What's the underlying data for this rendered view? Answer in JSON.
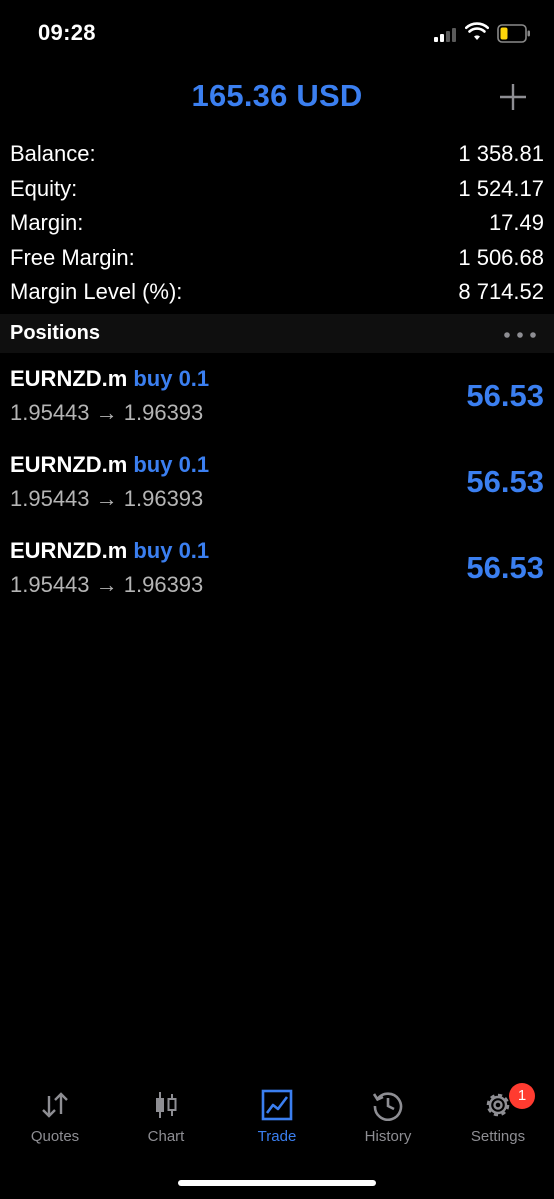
{
  "status_bar": {
    "time": "09:28"
  },
  "header": {
    "title": "165.36 USD",
    "add_icon": "plus-icon"
  },
  "summary": [
    {
      "label": "Balance:",
      "value": "1 358.81"
    },
    {
      "label": "Equity:",
      "value": "1 524.17"
    },
    {
      "label": "Margin:",
      "value": "17.49"
    },
    {
      "label": "Free Margin:",
      "value": "1 506.68"
    },
    {
      "label": "Margin Level (%):",
      "value": "8 714.52"
    }
  ],
  "positions": {
    "title": "Positions",
    "items": [
      {
        "symbol": "EURNZD.m",
        "type": "buy 0.1",
        "prices": "1.95443 → 1.96393",
        "profit": "56.53"
      },
      {
        "symbol": "EURNZD.m",
        "type": "buy 0.1",
        "prices": "1.95443 → 1.96393",
        "profit": "56.53"
      },
      {
        "symbol": "EURNZD.m",
        "type": "buy 0.1",
        "prices": "1.95443 → 1.96393",
        "profit": "56.53"
      }
    ]
  },
  "tabs": [
    {
      "label": "Quotes",
      "icon": "quotes-arrows-icon",
      "active": false
    },
    {
      "label": "Chart",
      "icon": "candlestick-icon",
      "active": false
    },
    {
      "label": "Trade",
      "icon": "trade-chart-icon",
      "active": true
    },
    {
      "label": "History",
      "icon": "history-clock-icon",
      "active": false
    },
    {
      "label": "Settings",
      "icon": "gear-icon",
      "active": false,
      "badge": "1"
    }
  ],
  "colors": {
    "accent": "#3b7ff0",
    "background": "#000000",
    "badge": "#ff3b30",
    "inactive": "#8e8e93"
  }
}
